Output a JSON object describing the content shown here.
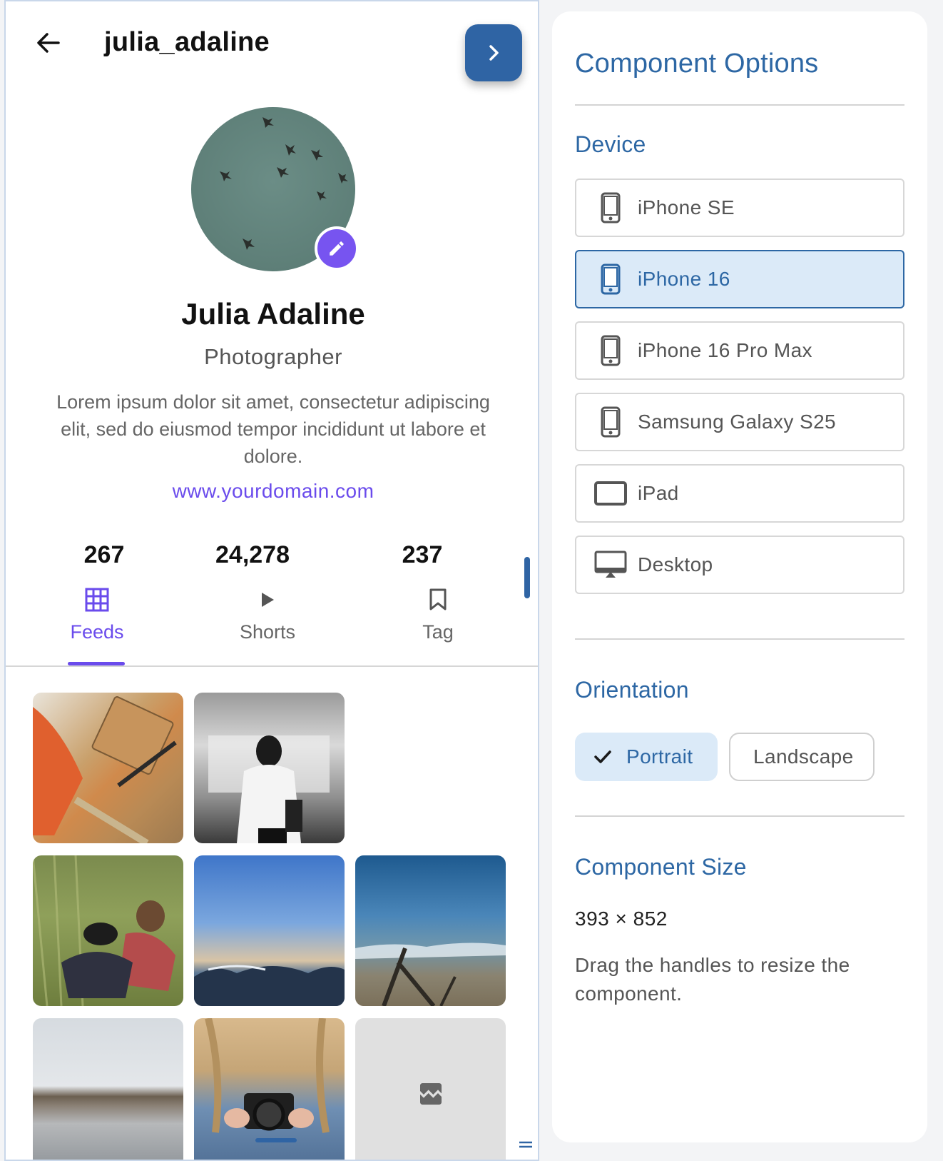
{
  "header": {
    "username": "julia_adaline"
  },
  "profile": {
    "name": "Julia Adaline",
    "role": "Photographer",
    "bio": "Lorem ipsum dolor sit amet, consectetur adipiscing elit, sed do eiusmod tempor incididunt ut labore et dolore.",
    "website": "www.yourdomain.com"
  },
  "stats": [
    {
      "value": "267"
    },
    {
      "value": "24,278"
    },
    {
      "value": "237"
    }
  ],
  "tabs": [
    {
      "label": "Feeds",
      "icon": "grid-icon",
      "active": true
    },
    {
      "label": "Shorts",
      "icon": "play-icon",
      "active": false
    },
    {
      "label": "Tag",
      "icon": "bookmark-icon",
      "active": false
    }
  ],
  "gallery": [
    {
      "subject": "desk-workspace"
    },
    {
      "subject": "woman-subway"
    },
    {
      "subject": ""
    },
    {
      "subject": "man-dog-grass"
    },
    {
      "subject": "sunset-waves"
    },
    {
      "subject": "beach-coast"
    },
    {
      "subject": "lake-shore"
    },
    {
      "subject": "camera-hands"
    },
    {
      "subject": "image-placeholder"
    }
  ],
  "panel": {
    "title": "Component Options",
    "device_heading": "Device",
    "devices": [
      {
        "label": "iPhone SE",
        "icon": "phone-icon",
        "selected": false
      },
      {
        "label": "iPhone 16",
        "icon": "phone-icon",
        "selected": true
      },
      {
        "label": "iPhone 16 Pro Max",
        "icon": "phone-icon",
        "selected": false
      },
      {
        "label": "Samsung Galaxy S25",
        "icon": "phone-icon",
        "selected": false
      },
      {
        "label": "iPad",
        "icon": "tablet-icon",
        "selected": false
      },
      {
        "label": "Desktop",
        "icon": "desktop-icon",
        "selected": false
      }
    ],
    "orientation_heading": "Orientation",
    "orientations": [
      {
        "label": "Portrait",
        "selected": true
      },
      {
        "label": "Landscape",
        "selected": false
      }
    ],
    "size_heading": "Component Size",
    "size_value": "393 × 852",
    "size_hint": "Drag the handles to resize the component."
  },
  "colors": {
    "accent": "#6a4bec",
    "primary": "#2d67a4",
    "selected_bg": "#dbeaf8"
  }
}
